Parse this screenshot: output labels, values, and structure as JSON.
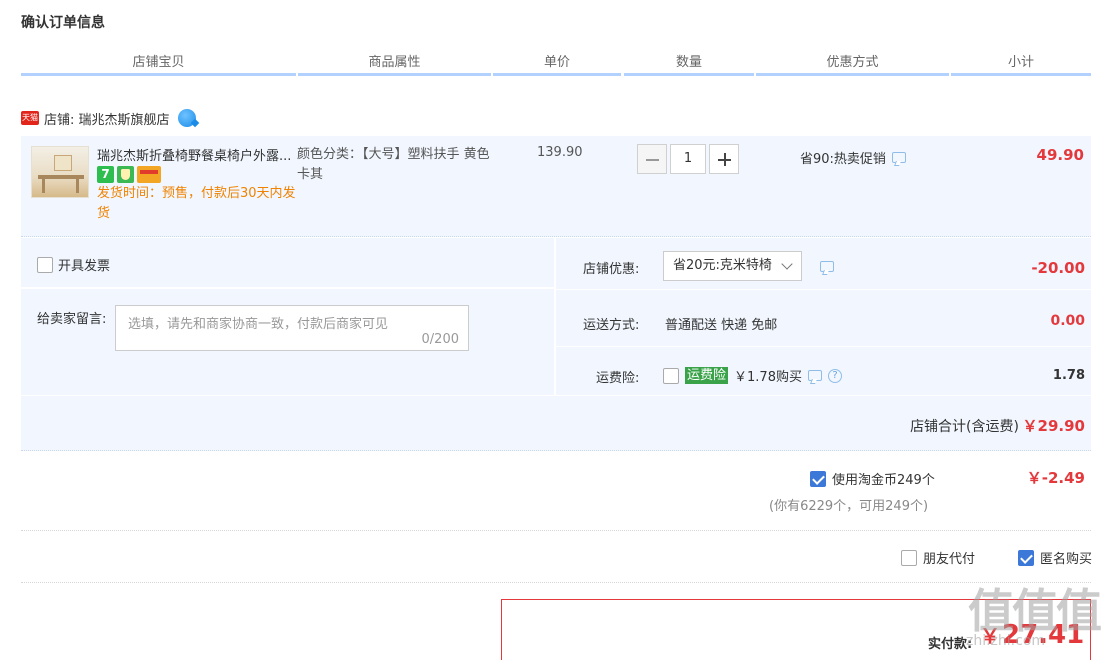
{
  "section_title": "确认订单信息",
  "columns": [
    "店铺宝贝",
    "商品属性",
    "单价",
    "数量",
    "优惠方式",
    "小计"
  ],
  "shop": {
    "badge": "天猫",
    "name": "店铺: 瑞兆杰斯旗舰店"
  },
  "item": {
    "title": "瑞兆杰斯折叠椅野餐桌椅户外露...",
    "badge_7": "7",
    "ship_time": "发货时间：预售，付款后30天内发货",
    "attrs": "颜色分类：【大号】塑料扶手 黄色卡其",
    "unit_price": "139.90",
    "quantity": "1",
    "promo": "省90:热卖促销",
    "subtotal": "49.90"
  },
  "invoice_label": "开具发票",
  "message": {
    "label": "给卖家留言:",
    "placeholder": "选填，请先和商家协商一致，付款后商家可见",
    "count": "0/200"
  },
  "shop_discount": {
    "label": "店铺优惠:",
    "selected": "省20元:克米特椅",
    "value": "-20.00"
  },
  "shipping": {
    "label": "运送方式:",
    "value": "普通配送 快递 免邮",
    "amount": "0.00"
  },
  "insurance": {
    "label": "运费险:",
    "tag": "运费险",
    "price": "￥1.78购买",
    "amount": "1.78"
  },
  "shop_total": {
    "label": "店铺合计(含运费)",
    "amount": "￥29.90"
  },
  "coins": {
    "label": "使用淘金币249个",
    "note": "(你有6229个，可用249个)",
    "amount": "￥-2.49"
  },
  "friend_pay": "朋友代付",
  "anonymous": "匿名购买",
  "payment": {
    "label": "实付款:",
    "currency": "￥",
    "amount": "27.41"
  },
  "watermark": {
    "main": "值值值",
    "sub": "zhi.zhi.com"
  }
}
